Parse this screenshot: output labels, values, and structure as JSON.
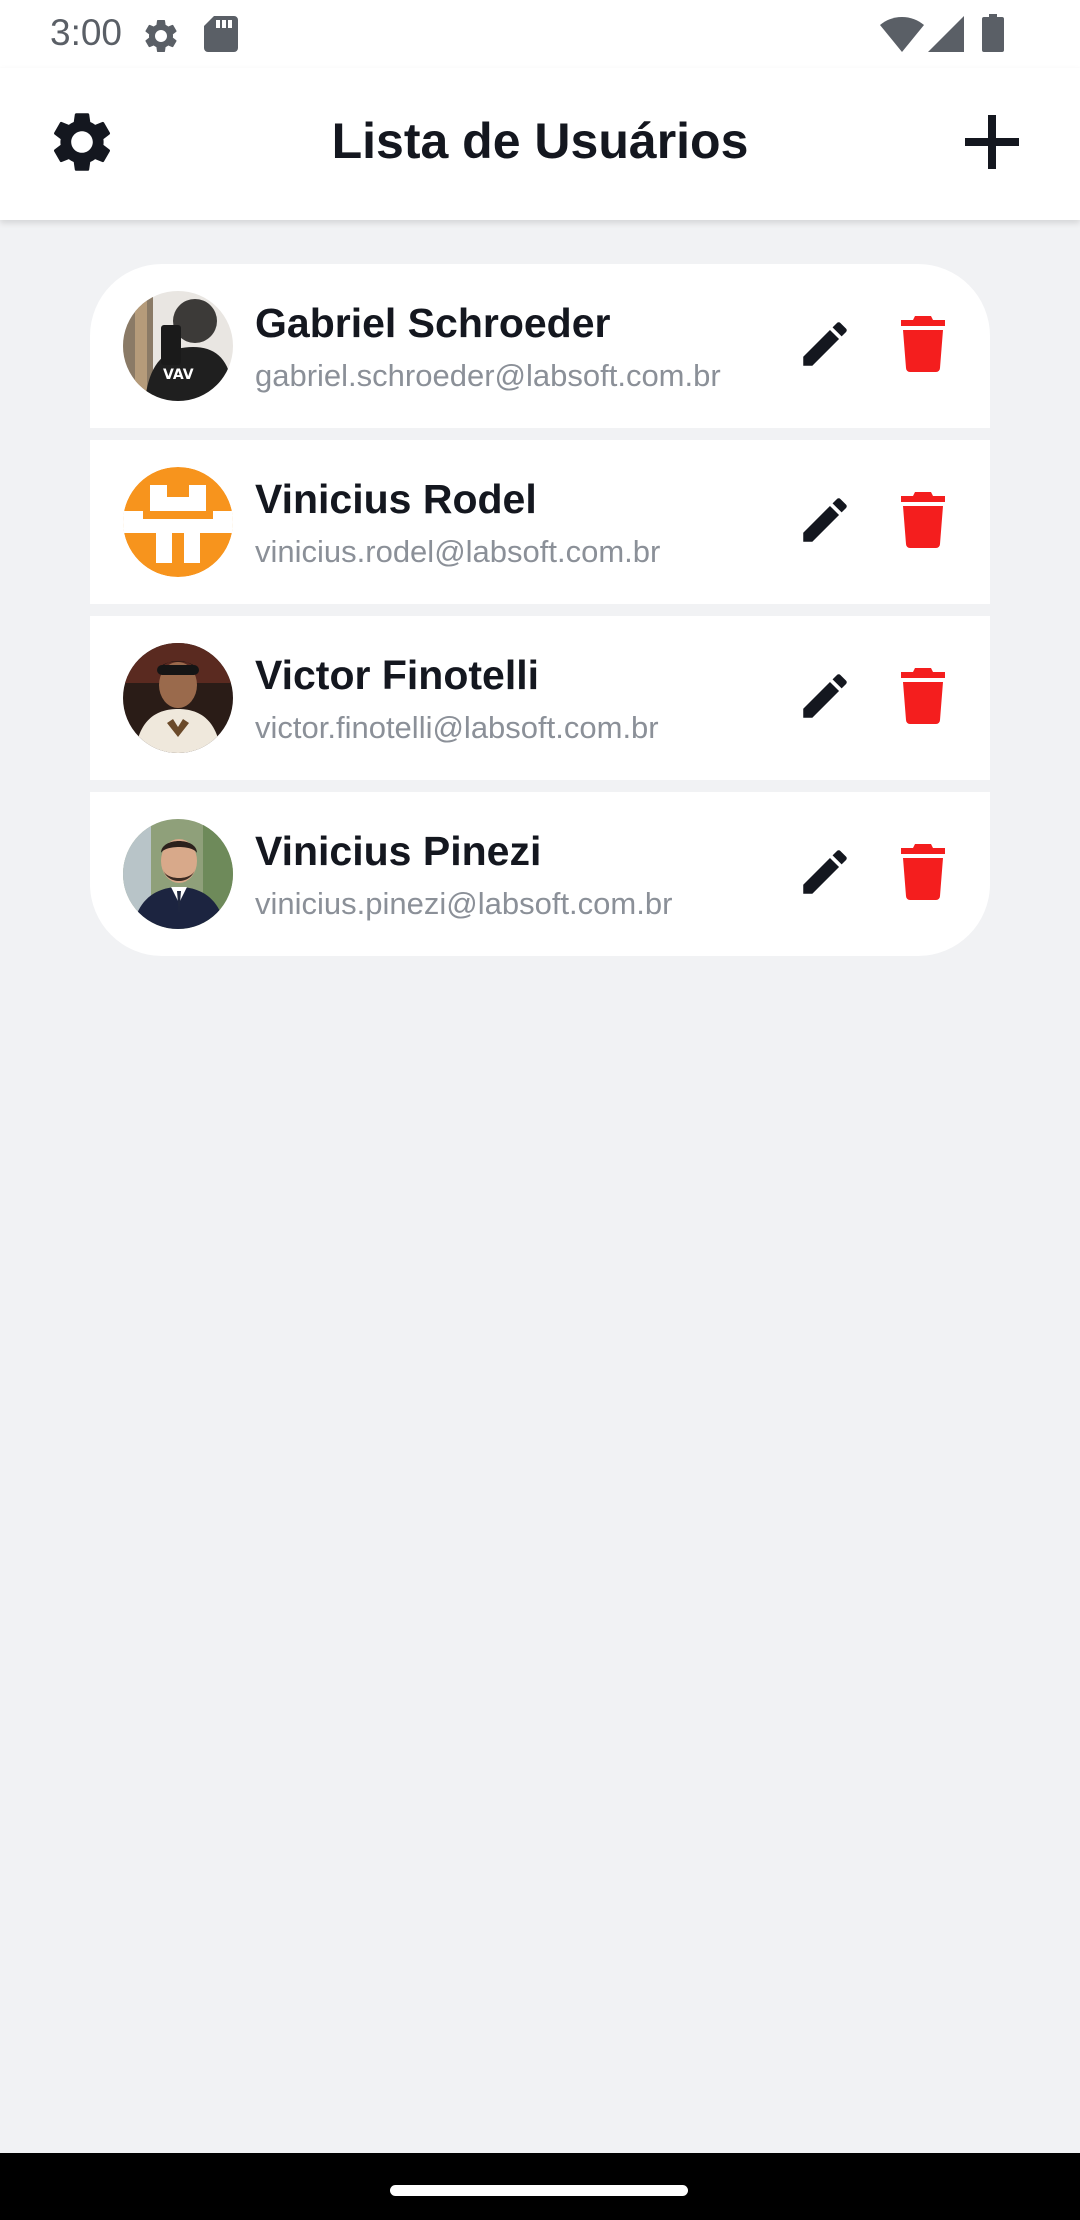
{
  "status_bar": {
    "time": "3:00"
  },
  "header": {
    "title": "Lista de Usuários",
    "settings_icon": "gear-icon",
    "add_icon": "plus-icon"
  },
  "users": [
    {
      "name": "Gabriel Schroeder",
      "email": "gabriel.schroeder@labsoft.com.br",
      "avatar": "photo"
    },
    {
      "name": "Vinicius Rodel",
      "email": "vinicius.rodel@labsoft.com.br",
      "avatar": "orange-pixel-logo"
    },
    {
      "name": "Victor Finotelli",
      "email": "victor.finotelli@labsoft.com.br",
      "avatar": "photo"
    },
    {
      "name": "Vinicius Pinezi",
      "email": "vinicius.pinezi@labsoft.com.br",
      "avatar": "photo"
    }
  ],
  "colors": {
    "background": "#f1f2f4",
    "text_primary": "#14171f",
    "text_secondary": "#8b9098",
    "delete": "#f41e1e",
    "edit": "#14171f",
    "avatar_orange": "#f7941d"
  }
}
